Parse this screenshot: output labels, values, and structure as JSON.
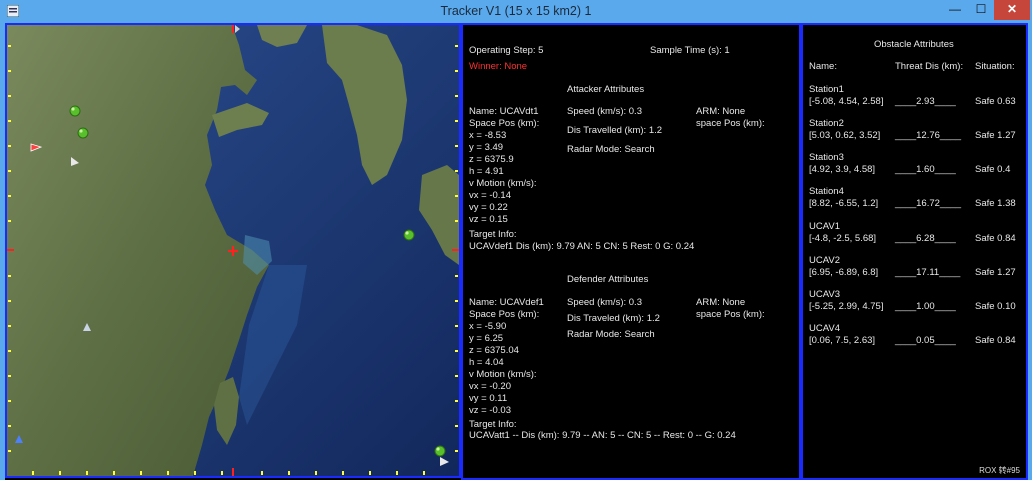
{
  "window": {
    "title": "Tracker  V1 (15 x 15 km2)  1",
    "minimize_glyph": "—",
    "maximize_glyph": "☐",
    "close_glyph": "✕"
  },
  "status": {
    "operating_step": "Operating Step: 5",
    "sample_time": "Sample Time (s): 1",
    "winner": "Winner: None"
  },
  "attacker": {
    "heading": "Attacker Attributes",
    "name": "Name: UCAVdt1",
    "space_pos_label": "Space Pos (km):",
    "x": "x = -8.53",
    "y": "y = 3.49",
    "z": "z = 6375.9",
    "h": "h = 4.91",
    "v_motion_label": "v Motion (km/s):",
    "vx": "vx = -0.14",
    "vy": "vy = 0.22",
    "vz": "vz = 0.15",
    "speed": "Speed (km/s): 0.3",
    "dis_travelled": "Dis Travelled (km): 1.2",
    "radar_mode": "Radar Mode: Search",
    "arm": "ARM: None",
    "arm_space_pos": "space Pos (km):",
    "target_info_label": "Target Info:",
    "target_info": "UCAVdef1     Dis (km): 9.79    AN: 5    CN: 5    Rest: 0    G: 0.24"
  },
  "defender": {
    "heading": "Defender Attributes",
    "name": "Name: UCAVdef1",
    "space_pos_label": "Space Pos (km):",
    "x": "x = -5.90",
    "y": "y = 6.25",
    "z": "z = 6375.04",
    "h": "h = 4.04",
    "v_motion_label": "v Motion (km/s):",
    "vx": "vx = -0.20",
    "vy": "vy = 0.11",
    "vz": "vz = -0.03",
    "speed": "Speed (km/s): 0.3",
    "dis_travelled": "Dis Traveled (km): 1.2",
    "radar_mode": "Radar Mode: Search",
    "arm": "ARM: None",
    "arm_space_pos": "space Pos (km):",
    "target_info_label": "Target Info:",
    "target_info": "UCAVatt1 -- Dis (km): 9.79 -- AN: 5 -- CN: 5 -- Rest: 0 -- G: 0.24"
  },
  "obstacles": {
    "heading": "Obstacle Attributes",
    "col_name": "Name:",
    "col_threat": "Threat Dis (km):",
    "col_situation": "Situation:",
    "items": [
      {
        "name": "Station1",
        "pos": "[-5.08, 4.54, 2.58]",
        "threat": "____2.93____",
        "situation": "Safe 0.63"
      },
      {
        "name": "Station2",
        "pos": "[5.03, 0.62, 3.52]",
        "threat": "____12.76____",
        "situation": "Safe 1.27"
      },
      {
        "name": "Station3",
        "pos": "[4.92, 3.9, 4.58]",
        "threat": "____1.60____",
        "situation": "Safe 0.4"
      },
      {
        "name": "Station4",
        "pos": "[8.82, -6.55, 1.2]",
        "threat": "____16.72____",
        "situation": "Safe 1.38"
      },
      {
        "name": "UCAV1",
        "pos": "[-4.8, -2.5, 5.68]",
        "threat": "____6.28____",
        "situation": "Safe 0.84"
      },
      {
        "name": "UCAV2",
        "pos": "[6.95, -6.89, 6.8]",
        "threat": "____17.11____",
        "situation": "Safe 1.27"
      },
      {
        "name": "UCAV3",
        "pos": "[-5.25, 2.99, 4.75]",
        "threat": "____1.00____",
        "situation": "Safe 0.10"
      },
      {
        "name": "UCAV4",
        "pos": "[0.06, 7.5, 2.63]",
        "threat": "____0.05____",
        "situation": "Safe 0.84"
      }
    ]
  },
  "watermark": "ROX 转#95",
  "colors": {
    "title_bar": "#5aa9ec",
    "panel_border": "#1a2bff",
    "winner_text": "#ff3030",
    "land": "#6a7a52",
    "sea": "#1c3a78",
    "grid_tick": "#ffff40",
    "axis_tick": "#ff2020"
  }
}
